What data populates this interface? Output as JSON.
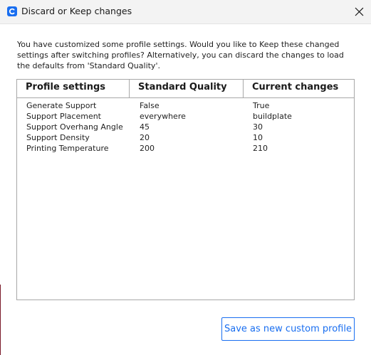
{
  "window": {
    "title": "Discard or Keep changes",
    "app_icon": "cura-app-icon",
    "close_icon": "close-icon"
  },
  "message": "You have customized some profile settings. Would you like to Keep these changed settings after switching profiles? Alternatively, you can discard the changes to load the defaults from 'Standard Quality'.",
  "table": {
    "headers": [
      "Profile settings",
      "Standard Quality",
      "Current changes"
    ],
    "rows": [
      [
        "Generate Support",
        "False",
        "True"
      ],
      [
        "Support Placement",
        "everywhere",
        "buildplate"
      ],
      [
        "Support Overhang Angle",
        "45",
        "30"
      ],
      [
        "Support Density",
        "20",
        "10"
      ],
      [
        "Printing Temperature",
        "200",
        "210"
      ]
    ]
  },
  "buttons": {
    "save_label": "Save as new custom profile"
  },
  "colors": {
    "accent": "#196ef0",
    "titlebar": "#f3f3f3",
    "border": "#a8a8a8"
  }
}
